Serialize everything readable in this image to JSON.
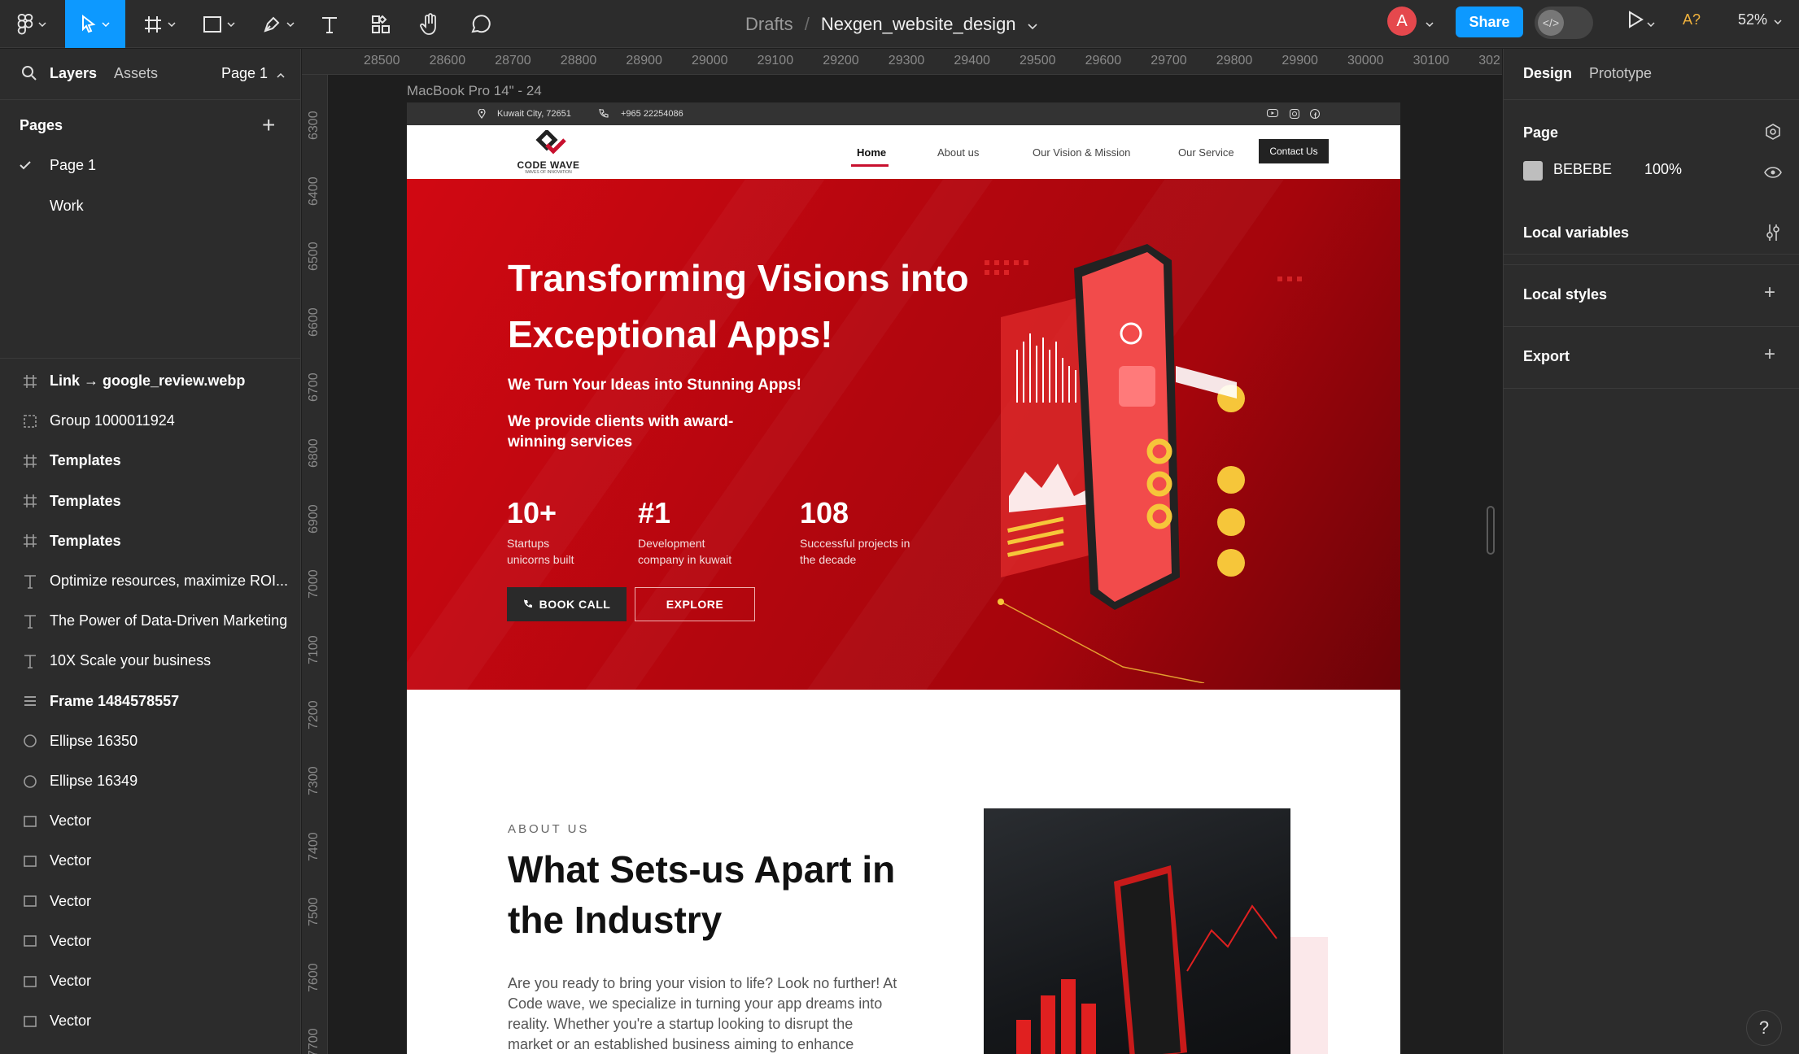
{
  "toolbar": {
    "breadcrumb_drafts": "Drafts",
    "breadcrumb_sep": "/",
    "file_name": "Nexgen_website_design",
    "avatar_initial": "A",
    "share_label": "Share",
    "accessibility_label": "A?",
    "zoom_label": "52%"
  },
  "left_panel": {
    "tab_layers": "Layers",
    "tab_assets": "Assets",
    "page_selector": "Page 1",
    "pages_heading": "Pages",
    "pages": [
      {
        "label": "Page 1",
        "selected": true
      },
      {
        "label": "Work",
        "selected": false
      }
    ],
    "layers": [
      {
        "label": "Link → google_review.webp",
        "icon": "frame-icon",
        "bold": true
      },
      {
        "label": "Group 1000011924",
        "icon": "group-icon",
        "bold": false
      },
      {
        "label": "Templates",
        "icon": "frame-icon",
        "bold": true
      },
      {
        "label": "Templates",
        "icon": "frame-icon",
        "bold": true
      },
      {
        "label": "Templates",
        "icon": "frame-icon",
        "bold": true
      },
      {
        "label": "Optimize resources, maximize ROI...",
        "icon": "text-icon",
        "bold": false
      },
      {
        "label": "The Power of Data-Driven Marketing",
        "icon": "text-icon",
        "bold": false
      },
      {
        "label": "10X Scale your business",
        "icon": "text-icon",
        "bold": false
      },
      {
        "label": "Frame 1484578557",
        "icon": "auto-layout-icon",
        "bold": true
      },
      {
        "label": "Ellipse 16350",
        "icon": "ellipse-icon",
        "bold": false
      },
      {
        "label": "Ellipse 16349",
        "icon": "ellipse-icon",
        "bold": false
      },
      {
        "label": "Vector",
        "icon": "vector-icon",
        "bold": false
      },
      {
        "label": "Vector",
        "icon": "vector-icon",
        "bold": false
      },
      {
        "label": "Vector",
        "icon": "vector-icon",
        "bold": false
      },
      {
        "label": "Vector",
        "icon": "vector-icon",
        "bold": false
      },
      {
        "label": "Vector",
        "icon": "vector-icon",
        "bold": false
      },
      {
        "label": "Vector",
        "icon": "vector-icon",
        "bold": false
      }
    ]
  },
  "rulers": {
    "top": [
      "28500",
      "28600",
      "28700",
      "28800",
      "28900",
      "29000",
      "29100",
      "29200",
      "29300",
      "29400",
      "29500",
      "29600",
      "29700",
      "29800",
      "29900",
      "30000",
      "30100",
      "302"
    ],
    "left": [
      "6300",
      "6400",
      "6500",
      "6600",
      "6700",
      "6800",
      "6900",
      "7000",
      "7100",
      "7200",
      "7300",
      "7400",
      "7500",
      "7600",
      "7700"
    ]
  },
  "canvas": {
    "frame_label": "MacBook Pro 14\" - 24"
  },
  "site": {
    "location": "Kuwait City, 72651",
    "phone": "+965 22254086",
    "logo_name": "CODE WAVE",
    "logo_tagline": "WAVES OF INNOVATION",
    "nav": {
      "home": "Home",
      "about": "About us",
      "vision": "Our Vision & Mission",
      "service": "Our Service",
      "contact": "Contact Us"
    },
    "hero": {
      "title": "Transforming Visions into Exceptional Apps!",
      "subtitle1": "We  Turn Your  Ideas into Stunning Apps!",
      "subtitle2": "We provide clients with award-winning services",
      "stats": [
        {
          "value": "10+",
          "label": "Startups unicorns built"
        },
        {
          "value": "#1",
          "label": "Development company in kuwait"
        },
        {
          "value": "108",
          "label": "Successful projects in the decade"
        }
      ],
      "book_call": "BOOK CALL",
      "explore": "EXPLORE"
    },
    "about": {
      "kicker": "ABOUT US",
      "title": "What Sets-us Apart in the Industry",
      "body": "Are you ready to bring your vision to life? Look no further! At Code wave, we specialize in turning your app dreams into reality. Whether you're a startup looking to disrupt the market or an established business aiming to enhance"
    }
  },
  "right_panel": {
    "tab_design": "Design",
    "tab_prototype": "Prototype",
    "page_heading": "Page",
    "page_fill_hex": "BEBEBE",
    "page_fill_opacity": "100%",
    "local_variables": "Local variables",
    "local_styles": "Local styles",
    "export": "Export",
    "help": "?"
  },
  "colors": {
    "accent": "#0d99ff",
    "hero_red": "#c8102e",
    "panel_bg": "#2c2c2c",
    "canvas_bg": "#1e1e1e"
  }
}
